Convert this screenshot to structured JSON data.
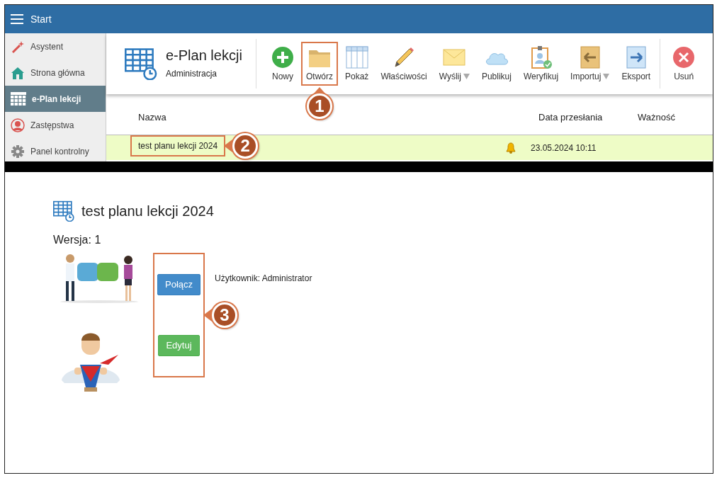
{
  "header": {
    "title": "Start"
  },
  "sidebar": {
    "items": [
      {
        "label": "Asystent",
        "selected": false
      },
      {
        "label": "Strona główna",
        "selected": false
      },
      {
        "label": "e-Plan lekcji",
        "selected": true
      },
      {
        "label": "Zastępstwa",
        "selected": false
      },
      {
        "label": "Panel kontrolny",
        "selected": false
      }
    ]
  },
  "module": {
    "title": "e-Plan lekcji",
    "subtitle": "Administracja"
  },
  "toolbar": {
    "items": [
      {
        "label": "Nowy",
        "dropdown": false
      },
      {
        "label": "Otwórz",
        "dropdown": false,
        "callout": {
          "number": "1"
        }
      },
      {
        "label": "Pokaż",
        "dropdown": false
      },
      {
        "label": "Właściwości",
        "dropdown": false
      },
      {
        "label": "Wyślij",
        "dropdown": true
      },
      {
        "label": "Publikuj",
        "dropdown": false
      },
      {
        "label": "Weryfikuj",
        "dropdown": false
      },
      {
        "label": "Importuj",
        "dropdown": true
      },
      {
        "label": "Eksport",
        "dropdown": false
      }
    ],
    "end_items": [
      {
        "label": "Usuń",
        "dropdown": false
      }
    ]
  },
  "table": {
    "columns": [
      {
        "label": "Nazwa"
      },
      {
        "label": "Data przesłania"
      },
      {
        "label": "Ważność"
      }
    ],
    "rows": [
      {
        "name": "test planu lekcji 2024",
        "selected": true,
        "alert": true,
        "date": "23.05.2024 10:11",
        "callout": {
          "number": "2"
        }
      }
    ]
  },
  "detail": {
    "title": "test planu lekcji 2024",
    "version": "Wersja: 1",
    "buttons": [
      {
        "label": "Połącz",
        "kind": "primary"
      },
      {
        "label": "Edytuj",
        "kind": "success"
      }
    ],
    "buttons_callout": {
      "number": "3"
    },
    "user": "Użytkownik: Administrator"
  }
}
